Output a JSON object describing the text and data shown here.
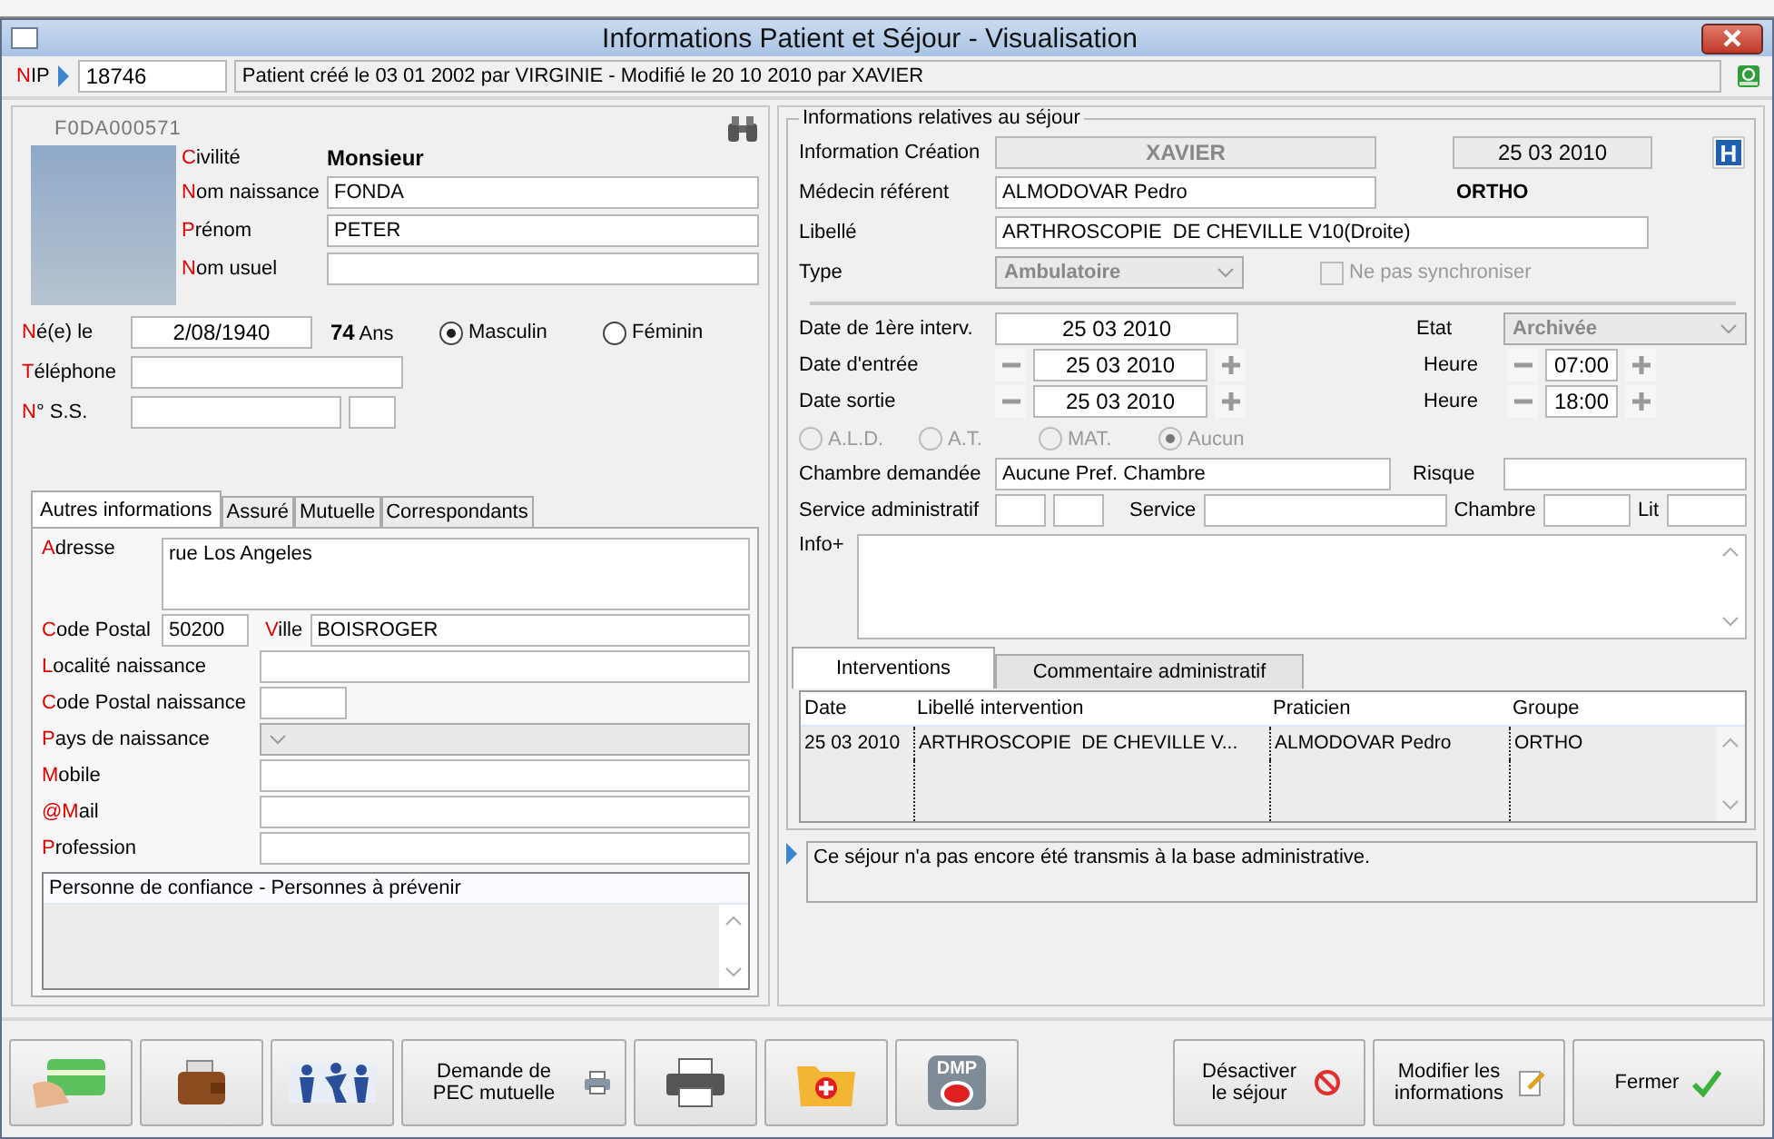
{
  "window": {
    "title": "Informations Patient et Séjour - Visualisation"
  },
  "header": {
    "nip_label": "NIP",
    "nip": "18746",
    "history": "Patient créé le 03 01 2002 par VIRGINIE - Modifié le 20 10 2010 par XAVIER"
  },
  "patient": {
    "code": "F0DA000571",
    "civility_label": "Civilité",
    "civility": "Monsieur",
    "fields": [
      {
        "label": "Nom naissance",
        "value": "FONDA"
      },
      {
        "label": "Prénom",
        "value": "PETER"
      },
      {
        "label": "Nom usuel"
      }
    ],
    "birth_label": "Né(e) le",
    "birth_date": "2/08/1940",
    "age": "74",
    "age_unit": "Ans",
    "sex": [
      {
        "label": "Masculin",
        "selected": true
      },
      {
        "label": "Féminin",
        "selected": false
      }
    ],
    "phone_label": "Téléphone",
    "ss_label": "N° S.S."
  },
  "tabs": [
    {
      "label": "Autres informations",
      "selected": true
    },
    {
      "label": "Assuré",
      "selected": false
    },
    {
      "label": "Mutuelle",
      "selected": false
    },
    {
      "label": "Correspondants",
      "selected": false
    }
  ],
  "other_info": {
    "address_label": "Adresse",
    "address": "rue Los Angeles",
    "postal_label": "Code Postal",
    "postal": "50200",
    "city_label": "Ville",
    "city": "BOISROGER",
    "fields": [
      {
        "kind": "text",
        "label": "Localité naissance"
      },
      {
        "kind": "short",
        "label": "Code Postal naissance"
      },
      {
        "kind": "select",
        "label": "Pays de naissance"
      },
      {
        "kind": "text",
        "label": "Mobile"
      },
      {
        "kind": "text",
        "label": "@Mail"
      },
      {
        "kind": "text",
        "label": "Profession"
      }
    ],
    "trusted_title": "Personne de confiance - Personnes à prévenir"
  },
  "stay": {
    "legend": "Informations relatives au séjour",
    "hospital_badge": "H",
    "creation_label": "Information Création",
    "creation_by": "XAVIER",
    "creation_date": "25 03 2010",
    "doctor_label": "Médecin référent",
    "doctor": "ALMODOVAR Pedro",
    "group": "ORTHO",
    "libelle_label": "Libellé",
    "libelle": "ARTHROSCOPIE  DE CHEVILLE V10(Droite)",
    "type_label": "Type",
    "type": "Ambulatoire",
    "type_disabled": true,
    "no_sync": {
      "label": "Ne pas synchroniser",
      "checked": false,
      "disabled": true
    },
    "first_interv_label": "Date de 1ère interv.",
    "first_interv": "25 03 2010",
    "state_label": "Etat",
    "state": "Archivée",
    "state_disabled": true,
    "dates": [
      {
        "label": "Date d'entrée",
        "date": "25 03 2010",
        "hour_label": "Heure",
        "hour": "07:00"
      },
      {
        "label": "Date sortie",
        "date": "25 03 2010",
        "hour_label": "Heure",
        "hour": "18:00"
      }
    ],
    "coverage_disabled": true,
    "coverage": [
      {
        "label": "A.L.D.",
        "selected": false
      },
      {
        "label": "A.T.",
        "selected": false
      },
      {
        "label": "MAT.",
        "selected": false
      },
      {
        "label": "Aucun",
        "selected": true
      }
    ],
    "room_requested_label": "Chambre demandée",
    "room_requested": "Aucune Pref. Chambre",
    "risk_label": "Risque",
    "service_admin_label": "Service administratif",
    "service_label": "Service",
    "room_label": "Chambre",
    "bed_label": "Lit",
    "info_label": "Info+"
  },
  "lower_tabs": [
    {
      "label": "Interventions",
      "selected": true
    },
    {
      "label": "Commentaire administratif",
      "selected": false
    }
  ],
  "table": {
    "columns": [
      "Date",
      "Libellé intervention",
      "Praticien",
      "Groupe"
    ],
    "rows": [
      [
        "25 03 2010",
        "ARTHROSCOPIE  DE CHEVILLE V...",
        "ALMODOVAR Pedro",
        "ORTHO"
      ]
    ]
  },
  "message": "Ce séjour n'a pas encore été transmis à la base administrative.",
  "toolbar": {
    "pec": "Demande de PEC mutuelle",
    "dmp": "DMP",
    "deactivate": "Désactiver le séjour",
    "modify": "Modifier les informations",
    "close": "Fermer"
  }
}
